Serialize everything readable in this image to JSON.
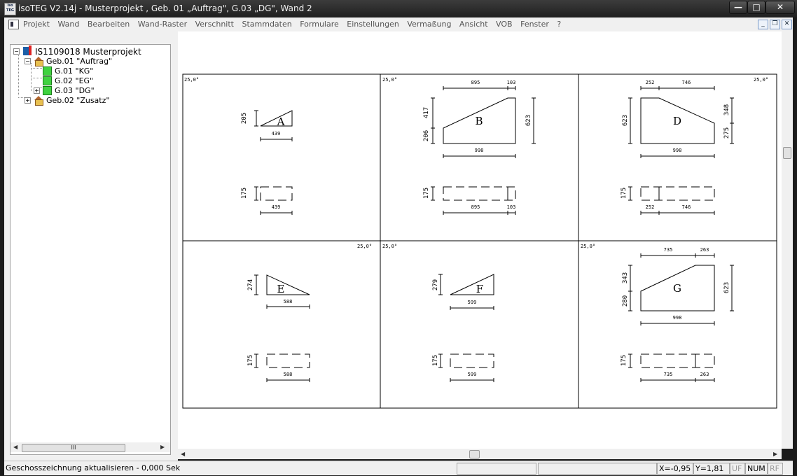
{
  "app": {
    "icon_text": "iso TEG",
    "title": "isoTEG V2.14j -   Musterprojekt , Geb. 01 „Auftrag\", G.03 „DG\", Wand 2"
  },
  "window_controls": {
    "minimize": "—",
    "maximize": "□",
    "close": "✕"
  },
  "menu": {
    "items": [
      "Projekt",
      "Wand",
      "Bearbeiten",
      "Wand-Raster",
      "Verschnitt",
      "Stammdaten",
      "Formulare",
      "Einstellungen",
      "Vermaßung",
      "Ansicht",
      "VOB",
      "Fenster",
      "?"
    ],
    "mdi_controls": [
      "_",
      "❐",
      "✕"
    ]
  },
  "tree": {
    "root": "IS1109018 Musterprojekt",
    "nodes": [
      {
        "label": "Geb.01 \"Auftrag\"",
        "expander": "−"
      },
      {
        "label": "G.01 \"KG\""
      },
      {
        "label": "G.02 \"EG\""
      },
      {
        "label": "G.03 \"DG\"",
        "expander": "+"
      },
      {
        "label": "Geb.02 \"Zusatz\"",
        "expander": "+"
      }
    ],
    "root_expander": "−",
    "hscroll_thumb": "III",
    "hscroll_left": "◀",
    "hscroll_right": "▶"
  },
  "drawing": {
    "panels": [
      {
        "letter": "A",
        "angle": "25,0°",
        "height": "205",
        "width": "439",
        "strip_height": "175",
        "strip_dims": [
          "439"
        ]
      },
      {
        "letter": "B",
        "angle": "25,0°",
        "top_dims": [
          "895",
          "103"
        ],
        "left_upper": "417",
        "left_lower": "206",
        "right": "623",
        "width": "998",
        "strip_height": "175",
        "strip_dims": [
          "895",
          "103"
        ]
      },
      {
        "letter": "D",
        "angle": "25,0°",
        "top_dims": [
          "252",
          "746"
        ],
        "left": "623",
        "right_upper": "348",
        "right_lower": "275",
        "width": "998",
        "strip_height": "175",
        "strip_dims": [
          "252",
          "746"
        ]
      },
      {
        "letter": "E",
        "angle": "25,0°",
        "height": "274",
        "width": "588",
        "strip_height": "175",
        "strip_dims": [
          "588"
        ]
      },
      {
        "letter": "F",
        "angle": "25,0°",
        "height": "279",
        "width": "599",
        "strip_height": "175",
        "strip_dims": [
          "599"
        ]
      },
      {
        "letter": "G",
        "angle": "25,0°",
        "top_dims": [
          "735",
          "263"
        ],
        "left_upper": "343",
        "left_lower": "280",
        "right": "623",
        "width": "998",
        "strip_height": "175",
        "strip_dims": [
          "735",
          "263"
        ]
      }
    ]
  },
  "scroll": {
    "left_arrow": "◀",
    "right_arrow": "▶"
  },
  "status": {
    "message": "Geschosszeichnung aktualisieren - 0,000 Sek",
    "x": "X=-0,95",
    "y": "Y=1,81",
    "uf": "UF",
    "num": "NUM",
    "rf": "RF"
  },
  "colors": {
    "title_bg": "#1f1f1f",
    "ui_bg": "#f0f0f0",
    "floor_icon": "#3fd23f"
  }
}
